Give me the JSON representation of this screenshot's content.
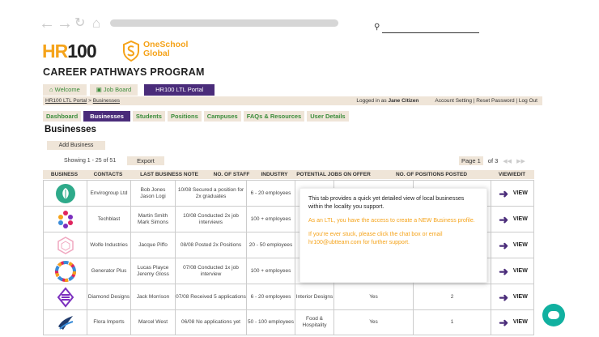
{
  "browser": {
    "back_icon": "arrow-left-icon",
    "forward_icon": "arrow-right-icon",
    "refresh_icon": "refresh-icon",
    "home_icon": "home-icon"
  },
  "header": {
    "logo_hr": "HR",
    "logo_num": "100",
    "partner_line1": "OneSchool",
    "partner_line2": "Global",
    "program_title": "CAREER PATHWAYS PROGRAM"
  },
  "top_tabs": [
    {
      "label": "Welcome",
      "icon": "home-icon"
    },
    {
      "label": "Job Board",
      "icon": "briefcase-icon"
    },
    {
      "label": "HR100 LTL Portal"
    }
  ],
  "crumb": {
    "portal": "HR100 LTL Portal",
    "sep": " > ",
    "current": "Businesses",
    "logged_prefix": "Logged in as",
    "user": "Jane Citizen",
    "account": "Account Setting | Reset Password | Log Out"
  },
  "sub_tabs": [
    "Dashboard",
    "Businesses",
    "Students",
    "Positions",
    "Campuses",
    "FAQs & Resources",
    "User Details"
  ],
  "section_title": "Businesses",
  "add_business": "Add Business",
  "showing": "Showing 1 - 25 of 51",
  "export": "Export",
  "pager": {
    "page": "Page 1",
    "of": "of 3"
  },
  "columns": [
    "BUSINESS",
    "CONTACTS",
    "LAST BUSINESS NOTE",
    "NO. OF STAFF",
    "INDUSTRY",
    "POTENTIAL JOBS ON OFFER",
    "NO. OF POSITIONS POSTED",
    "VIEW/EDIT"
  ],
  "rows": [
    {
      "logo": "green-leaf-logo",
      "business": "Envirogroup Ltd",
      "contacts": "Bob Jones\nJason Logi",
      "note": "10/08 Secured a position for 2x graduates",
      "staff": "6 - 20 employees",
      "industry": "",
      "jobs": "",
      "positions": "",
      "view": "VIEW"
    },
    {
      "logo": "colorful-dots-logo",
      "business": "Techblast",
      "contacts": "Martin Smith\nMark Simons",
      "note": "10/08 Conducted 2x job interviews",
      "staff": "100 + employees",
      "industry": "",
      "jobs": "",
      "positions": "",
      "view": "VIEW"
    },
    {
      "logo": "pink-hex-logo",
      "business": "Wolfe Industries",
      "contacts": "Jacque Piffo",
      "note": "08/08 Posted 2x Positions",
      "staff": "20 - 50 employees",
      "industry": "",
      "jobs": "",
      "positions": "",
      "view": "VIEW"
    },
    {
      "logo": "color-wheel-logo",
      "business": "Generator Plus",
      "contacts": "Lucas Playce\nJeremy Gloss",
      "note": "07/08 Conducted 1x job interview",
      "staff": "100 + employees",
      "industry": "",
      "jobs": "",
      "positions": "",
      "view": "VIEW"
    },
    {
      "logo": "purple-diamond-logo",
      "business": "Diamond Designs",
      "contacts": "Jack Morrison",
      "note": "07/08 Received 5 applications",
      "staff": "6 - 20 employees",
      "industry": "Interior Designs",
      "jobs": "Yes",
      "positions": "2",
      "view": "VIEW"
    },
    {
      "logo": "blue-wave-logo",
      "business": "Flora Imports",
      "contacts": "Marcel West",
      "note": "06/08 No applications yet",
      "staff": "50 - 100 employees",
      "industry": "Food & Hospitality",
      "jobs": "Yes",
      "positions": "1",
      "view": "VIEW"
    }
  ],
  "tooltip": {
    "p1": "This tab provides a quick yet detailed view of local businesses within the locality you support.",
    "p2": "As an LTL, you have the access to create a NEW Business profile.",
    "p3": "If you're ever stuck, please click the chat box or email hr100@ubtteam.com for further support."
  },
  "colors": {
    "accent_purple": "#4a2c7a",
    "brand_orange": "#f5a31a",
    "tab_bg": "#efe5d8",
    "tab_green": "#3a8c3a",
    "chat_teal": "#11b0a0"
  }
}
